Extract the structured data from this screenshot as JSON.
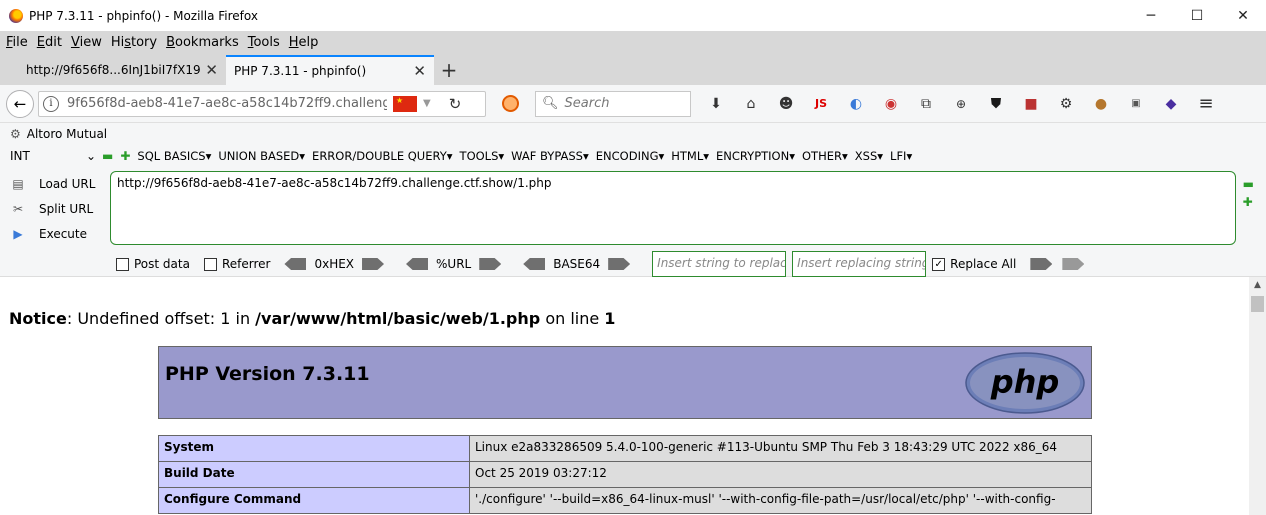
{
  "window": {
    "title": "PHP 7.3.11 - phpinfo() - Mozilla Firefox",
    "min": "─",
    "max": "☐",
    "close": "✕"
  },
  "menu": [
    {
      "label": "File",
      "key": "F"
    },
    {
      "label": "Edit",
      "key": "E"
    },
    {
      "label": "View",
      "key": "V"
    },
    {
      "label": "History",
      "key": "s"
    },
    {
      "label": "Bookmarks",
      "key": "B"
    },
    {
      "label": "Tools",
      "key": "T"
    },
    {
      "label": "Help",
      "key": "H"
    }
  ],
  "tabs": [
    {
      "label": "http://9f656f8...6InJ1biI7fX19",
      "close": "✕"
    },
    {
      "label": "PHP 7.3.11 - phpinfo()",
      "close": "✕"
    }
  ],
  "newtab": "+",
  "nav": {
    "back": "←",
    "url": "9f656f8d-aeb8-41e7-ae8c-a58c14b72ff9.challeng",
    "reload": "↻",
    "search_placeholder": "Search",
    "icons": [
      "download-icon",
      "home-icon",
      "face-icon",
      "js-icon",
      "color-icon",
      "red-icon",
      "screenshot-icon",
      "zoom-icon",
      "shield-icon",
      "n-icon",
      "gear-icon",
      "cookie-icon",
      "off-icon",
      "diamond-icon",
      "hamburger-menu-icon"
    ]
  },
  "bookmark": {
    "label": "Altoro Mutual"
  },
  "hackbar": {
    "select_value": "INT",
    "menus": [
      "SQL BASICS▾",
      "UNION BASED▾",
      "ERROR/DOUBLE QUERY▾",
      "TOOLS▾",
      "WAF BYPASS▾",
      "ENCODING▾",
      "HTML▾",
      "ENCRYPTION▾",
      "OTHER▾",
      "XSS▾",
      "LFI▾"
    ],
    "load_url": "Load URL",
    "split_url": "Split URL",
    "execute": "Execute",
    "textarea": "http://9f656f8d-aeb8-41e7-ae8c-a58c14b72ff9.challenge.ctf.show/1.php",
    "post_data": "Post data",
    "referrer": "Referrer",
    "hex": "0xHEX",
    "url_enc": "%URL",
    "base64": "BASE64",
    "insert_placeholder": "Insert string to replace",
    "replacing_placeholder": "Insert replacing string",
    "replace_all": "Replace All"
  },
  "page": {
    "notice_label": "Notice",
    "notice_text": ": Undefined offset: 1 in ",
    "notice_path": "/var/www/html/basic/web/1.php",
    "notice_line_text": " on line ",
    "notice_line": "1",
    "php_version": "PHP Version 7.3.11",
    "rows": [
      {
        "key": "System",
        "value": "Linux e2a833286509 5.4.0-100-generic #113-Ubuntu SMP Thu Feb 3 18:43:29 UTC 2022 x86_64"
      },
      {
        "key": "Build Date",
        "value": "Oct 25 2019 03:27:12"
      },
      {
        "key": "Configure Command",
        "value": "'./configure' '--build=x86_64-linux-musl' '--with-config-file-path=/usr/local/etc/php' '--with-config-"
      }
    ]
  }
}
